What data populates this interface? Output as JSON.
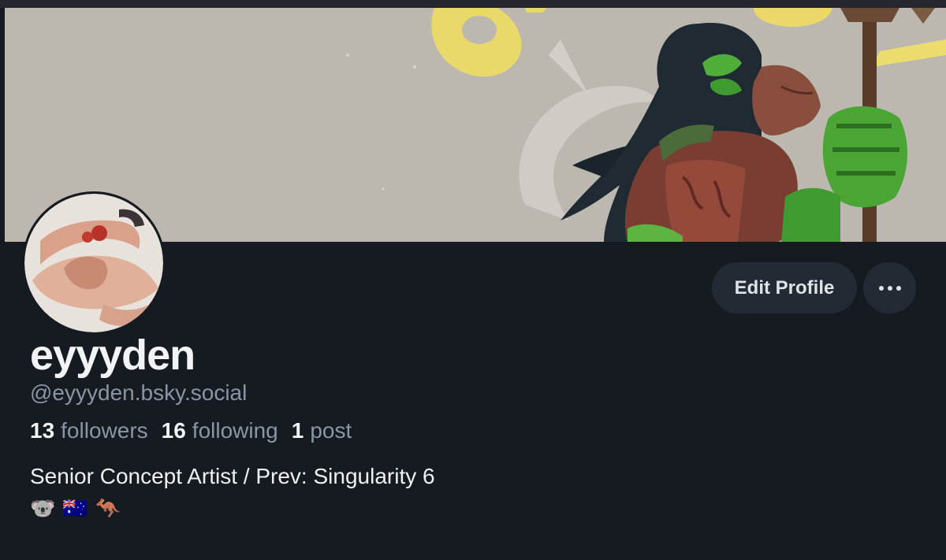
{
  "profile": {
    "display_name": "eyyyden",
    "handle": "@eyyyden.bsky.social",
    "bio": "Senior Concept Artist / Prev: Singularity 6",
    "emojis": [
      "🐨",
      "🇦🇺",
      "🦘"
    ]
  },
  "stats": {
    "followers_count": "13",
    "followers_label": "followers",
    "following_count": "16",
    "following_label": "following",
    "posts_count": "1",
    "posts_label": "post"
  },
  "actions": {
    "edit_label": "Edit Profile",
    "more_icon": "more-horizontal-icon"
  },
  "colors": {
    "background": "#161a21",
    "button": "#232a33",
    "muted_text": "#8a96a3",
    "text": "#f1f3f5"
  }
}
